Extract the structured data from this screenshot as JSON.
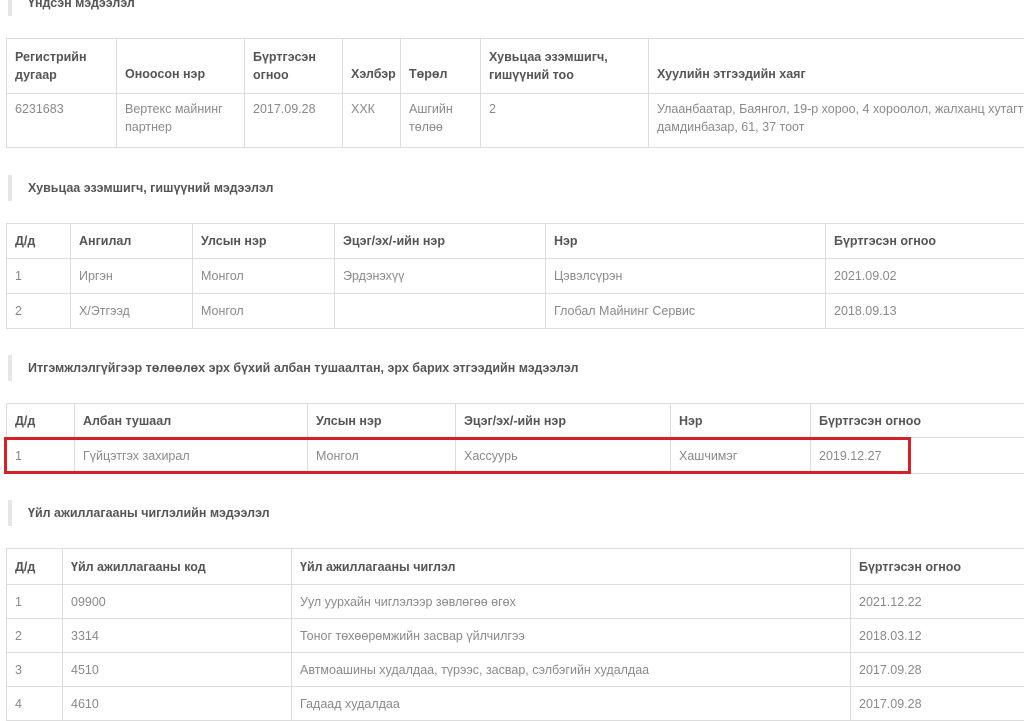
{
  "general": {
    "title": "Үндсэн мэдээлэл",
    "headers": [
      "Регистрийн дугаар",
      "Оноосон нэр",
      "Бүртгэсэн огноо",
      "Хэлбэр",
      "Төрөл",
      "Хувьцаа эзэмшигч, гишүүний тоо",
      "Хуулийн этгээдийн хаяг"
    ],
    "rows": [
      [
        "6231683",
        "Вертекс майнинг партнер",
        "2017.09.28",
        "ХХК",
        "Ашгийн төлөө",
        "2",
        "Улаанбаатар, Баянгол, 19-р хороо, 4 хороолол, жалханц хутагт дамдинбазар, 61, 37 тоот"
      ]
    ]
  },
  "shareholders": {
    "title": "Хувьцаа эзэмшигч, гишүүний мэдээлэл",
    "headers": [
      "Д/д",
      "Ангилал",
      "Улсын нэр",
      "Эцэг/эх/-ийн нэр",
      "Нэр",
      "Бүртгэсэн огноо"
    ],
    "rows": [
      [
        "1",
        "Иргэн",
        "Монгол",
        "Эрдэнэхүү",
        "Цэвэлсүрэн",
        "2021.09.02"
      ],
      [
        "2",
        "Х/Этгээд",
        "Монгол",
        "",
        "Глобал Майнинг Сервис",
        "2018.09.13"
      ]
    ]
  },
  "officials": {
    "title": "Итгэмжлэлгүйгээр төлөөлөх эрх бүхий албан тушаалтан, эрх барих этгээдийн мэдээлэл",
    "headers": [
      "Д/д",
      "Албан тушаал",
      "Улсын нэр",
      "Эцэг/эх/-ийн нэр",
      "Нэр",
      "Бүртгэсэн огноо"
    ],
    "rows": [
      [
        "1",
        "Гүйцэтгэх захирал",
        "Монгол",
        "Хассуурь",
        "Хашчимэг",
        "2019.12.27"
      ]
    ],
    "highlight_color": "#d62027"
  },
  "activities": {
    "title": "Үйл ажиллагааны чиглэлийн мэдээлэл",
    "headers": [
      "Д/д",
      "Үйл ажиллагааны код",
      "Үйл ажиллагааны чиглэл",
      "Бүртгэсэн огноо"
    ],
    "rows": [
      [
        "1",
        "09900",
        "Уул уурхайн чиглэлээр зөвлөгөө өгөх",
        "2021.12.22"
      ],
      [
        "2",
        "3314",
        "Тоног төхөөрөмжийн засвар үйлчилгээ",
        "2018.03.12"
      ],
      [
        "3",
        "4510",
        "Автмоашины худалдаа, түрээс, засвар, сэлбэгийн худалдаа",
        "2017.09.28"
      ],
      [
        "4",
        "4610",
        "Гадаад худалдаа",
        "2017.09.28"
      ]
    ]
  }
}
